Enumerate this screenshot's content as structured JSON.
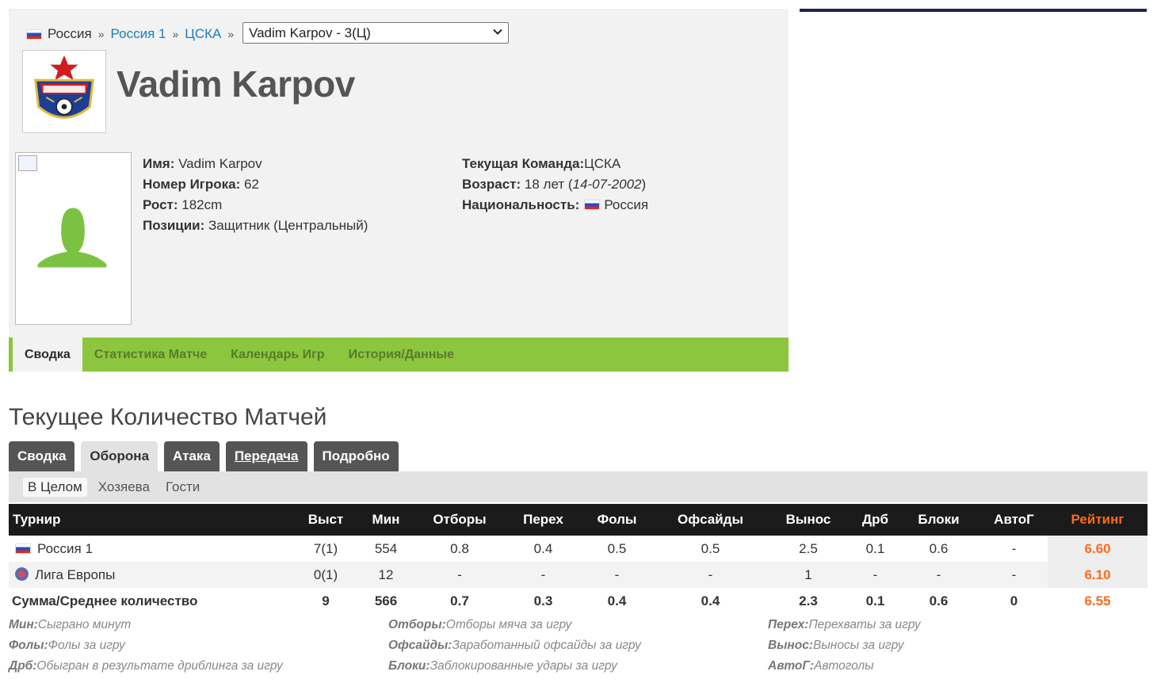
{
  "breadcrumb": {
    "country": "Россия",
    "league": "Россия 1",
    "team": "ЦСКА",
    "sep": "»"
  },
  "player_select": {
    "value": "Vadim Karpov - 3(Ц)"
  },
  "player": {
    "name": "Vadim Karpov",
    "left": [
      {
        "label": "Имя:",
        "value": "Vadim Karpov"
      },
      {
        "label": "Номер Игрока:",
        "value": "62"
      },
      {
        "label": "Рост:",
        "value": "182cm"
      },
      {
        "label": "Позиции:",
        "value": "Защитник (Центральный)"
      }
    ],
    "team_label": "Текущая Команда:",
    "team_value": "ЦСКА",
    "age_label": "Возраст:",
    "age_value": "18 лет (",
    "dob": "14-07-2002",
    "age_close": ")",
    "nat_label": "Национальность:",
    "nat_value": "Россия"
  },
  "nav": [
    "Сводка",
    "Статистика Матче",
    "Календарь Игр",
    "История/Данные"
  ],
  "section_title": "Текущее Количество Матчей",
  "stat_tabs": [
    "Сводка",
    "Оборона",
    "Атака",
    "Передача",
    "Подробно"
  ],
  "sub_tabs": [
    "В Целом",
    "Хозяева",
    "Гости"
  ],
  "table": {
    "headers": [
      "Турнир",
      "Выст",
      "Мин",
      "Отборы",
      "Перех",
      "Фолы",
      "Офсайды",
      "Вынос",
      "Дрб",
      "Блоки",
      "АвтоГ",
      "Рейтинг"
    ],
    "rows": [
      [
        "Россия 1",
        "7(1)",
        "554",
        "0.8",
        "0.4",
        "0.5",
        "0.5",
        "2.5",
        "0.1",
        "0.6",
        "-",
        "6.60"
      ],
      [
        "Лига Европы",
        "0(1)",
        "12",
        "-",
        "-",
        "-",
        "-",
        "1",
        "-",
        "-",
        "-",
        "6.10"
      ]
    ],
    "total": [
      "Сумма/Среднее количество",
      "9",
      "566",
      "0.7",
      "0.3",
      "0.4",
      "0.4",
      "2.3",
      "0.1",
      "0.6",
      "0",
      "6.55"
    ]
  },
  "legend": [
    [
      {
        "k": "Мин:",
        "v": "Сыграно минут"
      },
      {
        "k": "Фолы:",
        "v": "Фолы за игру"
      },
      {
        "k": "Дрб:",
        "v": "Обыгран в результате дриблинга за игру"
      }
    ],
    [
      {
        "k": "Отборы:",
        "v": "Отборы мяча за игру"
      },
      {
        "k": "Офсайды:",
        "v": "Заработанный офсайды за игру"
      },
      {
        "k": "Блоки:",
        "v": "Заблокированные удары за игру"
      }
    ],
    [
      {
        "k": "Перех:",
        "v": "Перехваты за игру"
      },
      {
        "k": "Вынос:",
        "v": "Выносы за игру"
      },
      {
        "k": "АвтоГ:",
        "v": "Автоголы"
      }
    ]
  ],
  "colors": {
    "nav_green": "#8cc63f",
    "rating_orange": "#ff6a1a",
    "link_blue": "#1a7dc1",
    "header_dark": "#1b1b1b",
    "club_red": "#c8102e",
    "club_blue": "#1c3f94"
  },
  "icons": [
    "flag-ru-icon",
    "chevron-down-icon",
    "club-logo-icon",
    "avatar-placeholder-icon",
    "europa-league-icon",
    "broken-image-icon"
  ]
}
